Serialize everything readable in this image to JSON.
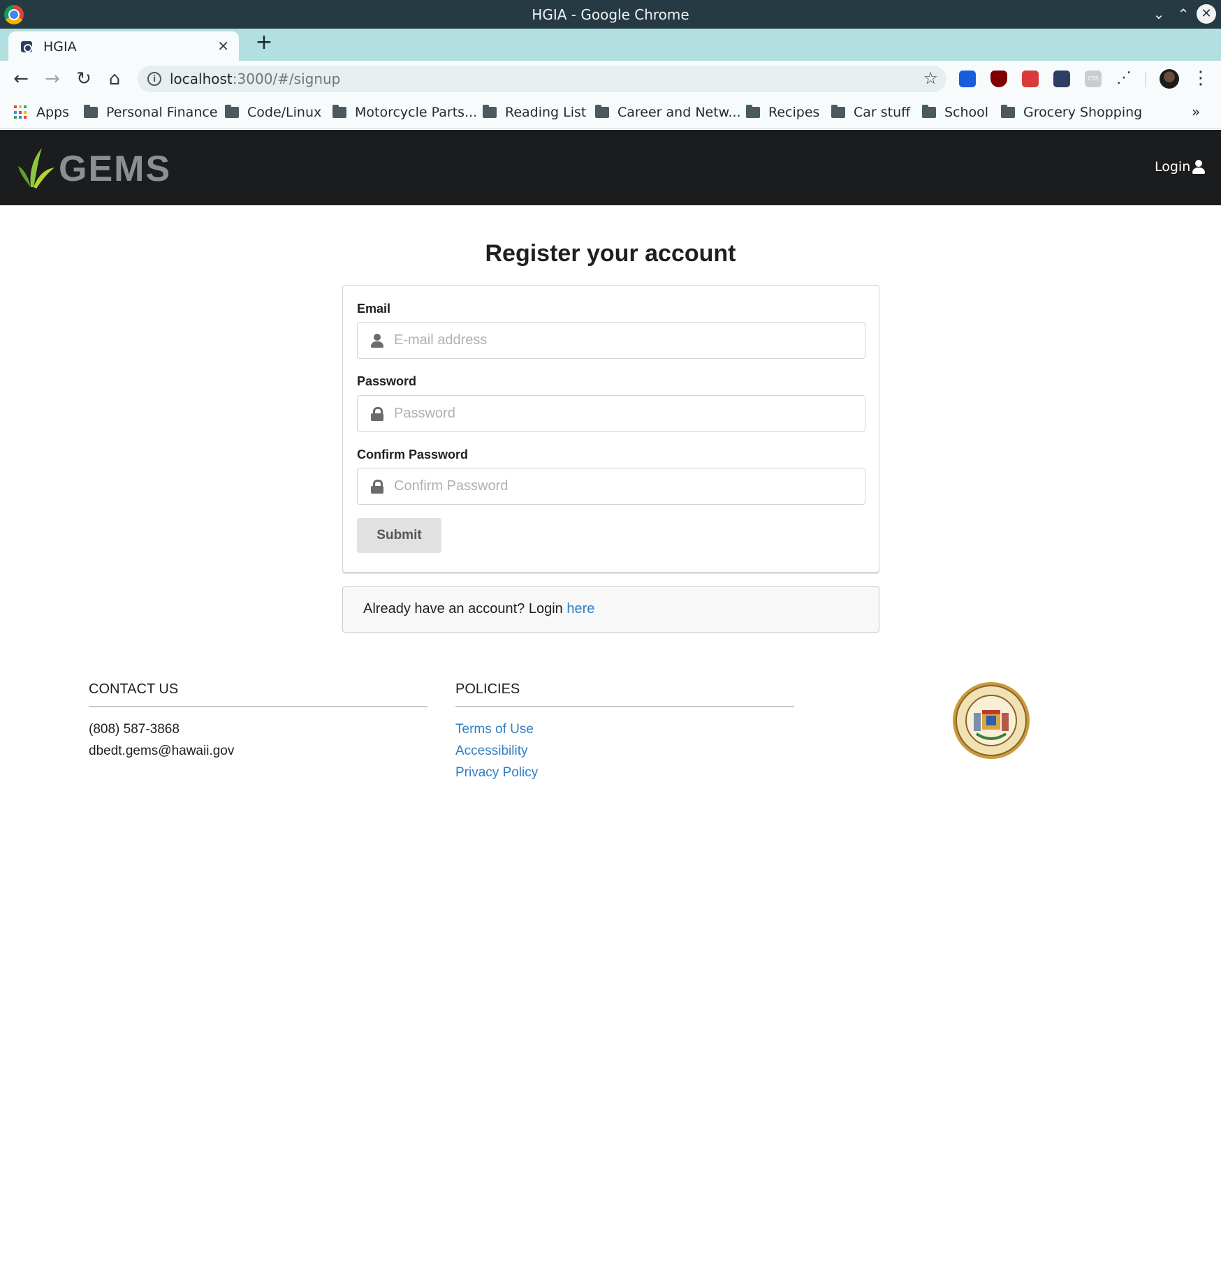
{
  "browser": {
    "window_title": "HGIA - Google Chrome",
    "tab_title": "HGIA",
    "url_host": "localhost",
    "url_rest": ":3000/#/signup",
    "bookmarks": [
      {
        "label": "Apps",
        "icon": "apps-grid-icon"
      },
      {
        "label": "Personal Finance",
        "icon": "folder-icon"
      },
      {
        "label": "Code/Linux",
        "icon": "folder-icon"
      },
      {
        "label": "Motorcycle Parts...",
        "icon": "folder-icon"
      },
      {
        "label": "Reading List",
        "icon": "folder-icon"
      },
      {
        "label": "Career and Netw...",
        "icon": "folder-icon"
      },
      {
        "label": "Recipes",
        "icon": "folder-icon"
      },
      {
        "label": "Car stuff",
        "icon": "folder-icon"
      },
      {
        "label": "School",
        "icon": "folder-icon"
      },
      {
        "label": "Grocery Shopping",
        "icon": "folder-icon"
      }
    ],
    "overflow_label": "»"
  },
  "navbar": {
    "brand": "GEMS",
    "login_label": "Login",
    "brand_green": "#8dc63f",
    "background": "#1b1c1d"
  },
  "form": {
    "title": "Register your account",
    "email": {
      "label": "Email",
      "placeholder": "E-mail address"
    },
    "password": {
      "label": "Password",
      "placeholder": "Password"
    },
    "confirm": {
      "label": "Confirm Password",
      "placeholder": "Confirm Password"
    },
    "submit_label": "Submit"
  },
  "message": {
    "text": "Already have an account? Login ",
    "link_label": "here"
  },
  "footer": {
    "contact": {
      "heading": "CONTACT US",
      "phone": "(808) 587-3868",
      "email": "dbedt.gems@hawaii.gov"
    },
    "policies": {
      "heading": "POLICIES",
      "links": [
        "Terms of Use",
        "Accessibility",
        "Privacy Policy"
      ]
    },
    "link_color": "#2f7fc4"
  }
}
